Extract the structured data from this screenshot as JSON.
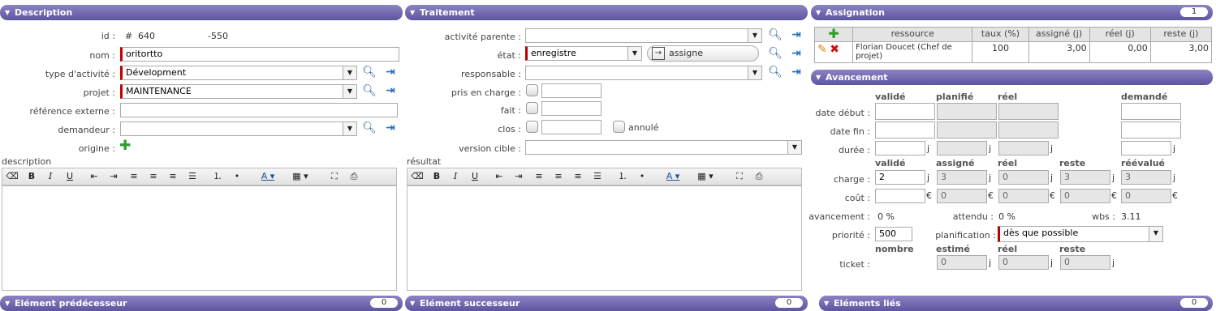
{
  "sections": {
    "description": "Description",
    "traitement": "Traitement",
    "assignation": "Assignation",
    "assignation_count": "1",
    "avancement": "Avancement",
    "predecesseur": "Elément prédécesseur",
    "predecesseur_count": "0",
    "successeur": "Elément successeur",
    "successeur_count": "0",
    "lies": "Eléments liés",
    "lies_count": "0"
  },
  "description": {
    "id_label": "id :",
    "id_hash": "#",
    "id_value": "640",
    "id_ref": "-550",
    "nom_label": "nom :",
    "nom_value": "oritortto",
    "type_label": "type d'activité :",
    "type_value": "Dévelopment",
    "projet_label": "projet :",
    "projet_value": "MAINTENANCE",
    "ref_label": "référence externe :",
    "ref_value": "",
    "demandeur_label": "demandeur :",
    "demandeur_value": "",
    "origine_label": "origine :",
    "desc_label": "description"
  },
  "traitement": {
    "parent_label": "activité parente :",
    "parent_value": "",
    "etat_label": "état :",
    "etat_value": "enregistre",
    "assign_button": "assigne",
    "resp_label": "responsable :",
    "resp_value": "",
    "prise_label": "pris en charge :",
    "fait_label": "fait :",
    "clos_label": "clos :",
    "annule_label": "annulé",
    "version_label": "version cible :",
    "version_value": "",
    "resultat_label": "résultat"
  },
  "assignation": {
    "headers": [
      "ressource",
      "taux (%)",
      "assigné (j)",
      "réel (j)",
      "reste (j)"
    ],
    "rows": [
      {
        "ressource": "Florian Doucet (Chef de projet)",
        "taux": "100",
        "assigne": "3,00",
        "reel": "0,00",
        "reste": "3,00"
      }
    ]
  },
  "avancement": {
    "col_valide": "validé",
    "col_planifie": "planifié",
    "col_reel": "réel",
    "col_demande": "demandé",
    "date_debut_label": "date début :",
    "date_fin_label": "date fin :",
    "duree_label": "durée :",
    "col2_valide": "validé",
    "col2_assigne": "assigné",
    "col2_reel": "réel",
    "col2_reste": "reste",
    "col2_reevalue": "réévalué",
    "charge_label": "charge :",
    "charge_valide": "2",
    "charge_assigne": "3",
    "charge_reel": "0",
    "charge_reste": "3",
    "charge_reevalue": "3",
    "cout_label": "coût :",
    "cout_assigne": "0",
    "cout_reel": "0",
    "cout_reste": "0",
    "cout_reevalue": "0",
    "avancement_label": "avancement :",
    "avancement_value": "0 %",
    "attendu_label": "attendu :",
    "attendu_value": "0 %",
    "wbs_label": "wbs :",
    "wbs_value": "3.11",
    "priorite_label": "priorité :",
    "priorite_value": "500",
    "planif_label": "planification :",
    "planif_value": "dès que possible",
    "col3_nombre": "nombre",
    "col3_estime": "estimé",
    "col3_reel": "réel",
    "col3_reste": "reste",
    "ticket_label": "ticket :",
    "ticket_estime": "0",
    "ticket_reel": "0",
    "ticket_reste": "0",
    "unit_j": "j",
    "unit_euro": "€"
  }
}
